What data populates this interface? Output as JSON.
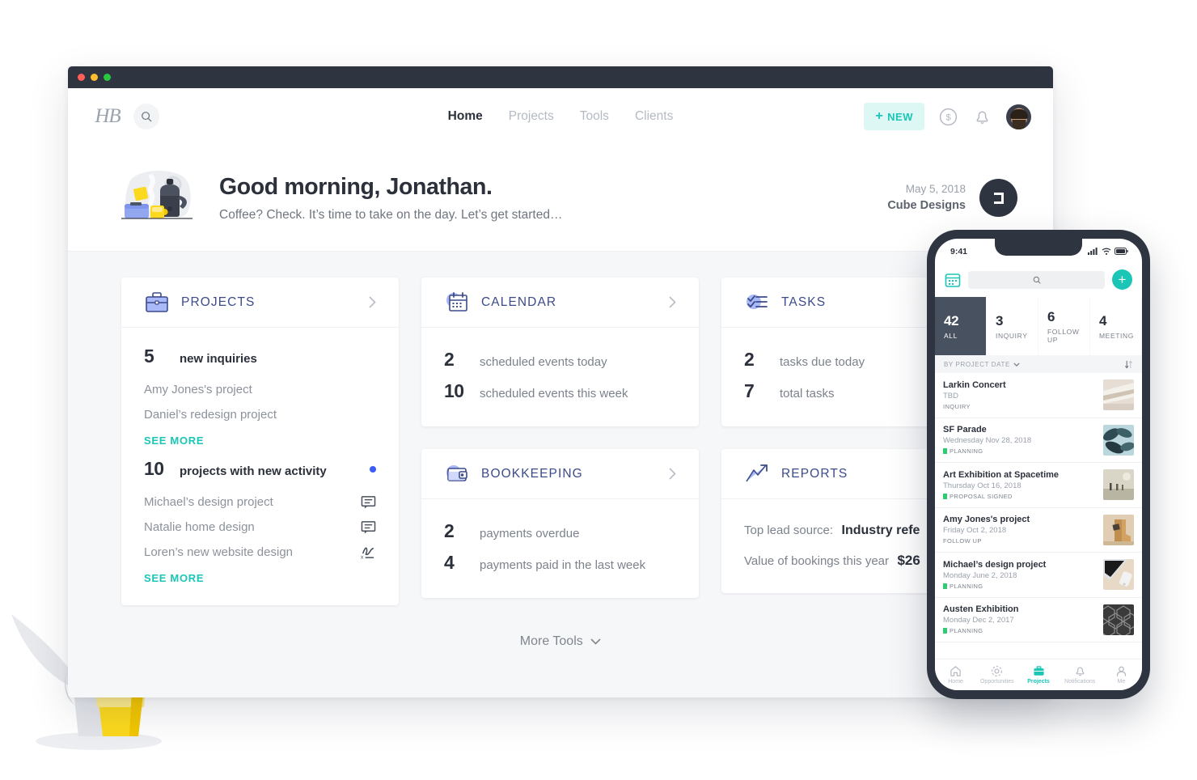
{
  "window": {
    "traffic_lights": [
      "close",
      "minimize",
      "maximize"
    ]
  },
  "navbar": {
    "logo_text": "HB",
    "search_icon": "search-icon",
    "links": [
      {
        "label": "Home",
        "active": true
      },
      {
        "label": "Projects",
        "active": false
      },
      {
        "label": "Tools",
        "active": false
      },
      {
        "label": "Clients",
        "active": false
      }
    ],
    "new_button": {
      "label": "NEW",
      "plus": "+"
    },
    "money_icon": "dollar-circle-icon",
    "bell_icon": "bell-icon",
    "avatar": "user-avatar"
  },
  "greeting": {
    "illustration": "coffee-breakfast-illustration",
    "title": "Good morning, Jonathan.",
    "subtitle": "Coffee? Check. It’s time to take on the day. Let’s get started…",
    "date": "May 5, 2018",
    "company": "Cube Designs",
    "company_logo": "cube-designs-logo"
  },
  "cards": {
    "projects": {
      "title": "PROJECTS",
      "icon": "briefcase-icon",
      "chevron": "chevron-right-icon",
      "stat1": {
        "num": "5",
        "label": "new inquiries"
      },
      "items1": [
        {
          "name": "Amy Jones's project",
          "icon": null
        },
        {
          "name": "Daniel’s redesign project",
          "icon": null
        }
      ],
      "see_more_1": "SEE MORE",
      "stat2": {
        "num": "10",
        "label": "projects with new activity",
        "badge": "unread-dot"
      },
      "items2": [
        {
          "name": "Michael’s design project",
          "icon": "comment-icon"
        },
        {
          "name": "Natalie home design",
          "icon": "comment-icon"
        },
        {
          "name": "Loren’s new website design",
          "icon": "signature-icon"
        }
      ],
      "see_more_2": "SEE MORE"
    },
    "calendar": {
      "title": "CALENDAR",
      "icon": "calendar-icon",
      "chevron": "chevron-right-icon",
      "rows": [
        {
          "num": "2",
          "label": "scheduled events today"
        },
        {
          "num": "10",
          "label": "scheduled events this week"
        }
      ]
    },
    "bookkeeping": {
      "title": "BOOKKEEPING",
      "icon": "wallet-icon",
      "chevron": "chevron-right-icon",
      "rows": [
        {
          "num": "2",
          "label": "payments overdue"
        },
        {
          "num": "4",
          "label": "payments paid in the last week"
        }
      ]
    },
    "tasks": {
      "title": "TASKS",
      "icon": "checklist-icon",
      "rows": [
        {
          "num": "2",
          "label": "tasks due today"
        },
        {
          "num": "7",
          "label": "total tasks"
        }
      ]
    },
    "reports": {
      "title": "REPORTS",
      "icon": "chart-arrow-icon",
      "rows": [
        {
          "label": "Top lead source:",
          "value": "Industry refe"
        },
        {
          "label": "Value of bookings this year",
          "value": "$26"
        }
      ]
    }
  },
  "more_tools": {
    "label": "More Tools",
    "chevron": "chevron-down-icon"
  },
  "phone": {
    "status": {
      "time": "9:41",
      "signal": "signal-icon",
      "wifi": "wifi-icon",
      "battery": "battery-icon"
    },
    "toolbar": {
      "calendar_icon": "calendar-icon",
      "search_icon": "search-icon",
      "add_label": "+"
    },
    "filters": [
      {
        "num": "42",
        "label": "ALL",
        "active": true
      },
      {
        "num": "3",
        "label": "INQUIRY",
        "active": false
      },
      {
        "num": "6",
        "label": "FOLLOW UP",
        "active": false
      },
      {
        "num": "4",
        "label": "MEETING",
        "active": false
      }
    ],
    "sort": {
      "label": "BY PROJECT DATE",
      "chevron": "chevron-down-icon",
      "direction_icon": "sort-arrows-icon"
    },
    "projects": [
      {
        "name": "Larkin Concert",
        "date": "TBD",
        "status": "INQUIRY",
        "flag": false,
        "thumb": "fabric-thumb"
      },
      {
        "name": "SF Parade",
        "date": "Wednesday Nov 28, 2018",
        "status": "PLANNING",
        "flag": true,
        "thumb": "plant-thumb"
      },
      {
        "name": "Art Exhibition at Spacetime",
        "date": "Thursday Oct 16, 2018",
        "status": "PROPOSAL SIGNED",
        "flag": true,
        "thumb": "gallery-thumb"
      },
      {
        "name": "Amy Jones's project",
        "date": "Friday Oct 2, 2018",
        "status": "FOLLOW UP",
        "flag": false,
        "thumb": "boots-thumb"
      },
      {
        "name": "Michael’s design project",
        "date": "Monday June 2, 2018",
        "status": "PLANNING",
        "flag": true,
        "thumb": "phone-thumb"
      },
      {
        "name": "Austen Exhibition",
        "date": "Monday Dec 2, 2017",
        "status": "PLANNING",
        "flag": true,
        "thumb": "geometric-thumb"
      }
    ],
    "tabs": [
      {
        "label": "Home",
        "icon": "home-icon",
        "active": false
      },
      {
        "label": "Opportunities",
        "icon": "target-icon",
        "active": false
      },
      {
        "label": "Projects",
        "icon": "briefcase-icon",
        "active": true
      },
      {
        "label": "Notifications",
        "icon": "bell-icon",
        "active": false
      },
      {
        "label": "Me",
        "icon": "person-icon",
        "active": false
      }
    ]
  },
  "colors": {
    "accent_teal": "#1bc6b6",
    "dark": "#2e3440",
    "card_title": "#3c4b8a",
    "icon_blue": "#8fa2f5",
    "background": "#f6f7f9",
    "status_green": "#2ecc71",
    "unread_blue": "#3b5bfd",
    "coffee_yellow": "#fcd91e"
  }
}
